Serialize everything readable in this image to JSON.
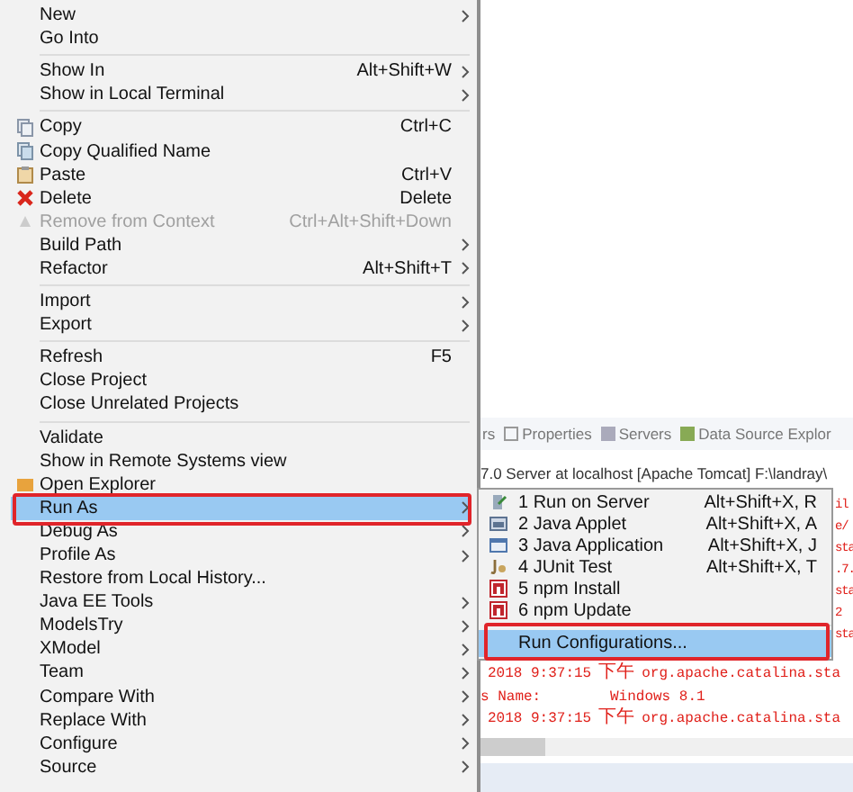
{
  "context_menu": {
    "sections": [
      [
        {
          "label": "New",
          "submenu": true,
          "disabled": false,
          "selected": false
        },
        {
          "label": "Go Into",
          "submenu": false,
          "disabled": false,
          "selected": false
        }
      ],
      [
        {
          "label": "Show In",
          "shortcut": "Alt+Shift+W",
          "submenu": true,
          "disabled": false,
          "selected": false
        },
        {
          "label": "Show in Local Terminal",
          "submenu": true,
          "disabled": false,
          "selected": false
        }
      ],
      [
        {
          "label": "Copy",
          "shortcut": "Ctrl+C",
          "submenu": false,
          "disabled": false,
          "selected": false
        },
        {
          "label": "Copy Qualified Name",
          "submenu": false,
          "disabled": false,
          "selected": false
        },
        {
          "label": "Paste",
          "shortcut": "Ctrl+V",
          "submenu": false,
          "disabled": false,
          "selected": false
        },
        {
          "label": "Delete",
          "shortcut": "Delete",
          "submenu": false,
          "disabled": false,
          "selected": false
        },
        {
          "label": "Remove from Context",
          "shortcut": "Ctrl+Alt+Shift+Down",
          "submenu": false,
          "disabled": true,
          "selected": false
        },
        {
          "label": "Build Path",
          "submenu": true,
          "disabled": false,
          "selected": false
        },
        {
          "label": "Refactor",
          "shortcut": "Alt+Shift+T",
          "submenu": true,
          "disabled": false,
          "selected": false
        }
      ],
      [
        {
          "label": "Import",
          "submenu": true,
          "disabled": false,
          "selected": false
        },
        {
          "label": "Export",
          "submenu": true,
          "disabled": false,
          "selected": false
        }
      ],
      [
        {
          "label": "Refresh",
          "shortcut": "F5",
          "submenu": false,
          "disabled": false,
          "selected": false
        },
        {
          "label": "Close Project",
          "submenu": false,
          "disabled": false,
          "selected": false
        },
        {
          "label": "Close Unrelated Projects",
          "submenu": false,
          "disabled": false,
          "selected": false
        }
      ],
      [
        {
          "label": "Validate",
          "submenu": false,
          "disabled": false,
          "selected": false
        },
        {
          "label": "Show in Remote Systems view",
          "submenu": false,
          "disabled": false,
          "selected": false
        },
        {
          "label": "Open Explorer",
          "submenu": false,
          "disabled": false,
          "selected": false
        },
        {
          "label": "Run As",
          "submenu": true,
          "disabled": false,
          "selected": true
        },
        {
          "label": "Debug As",
          "submenu": true,
          "disabled": false,
          "selected": false
        },
        {
          "label": "Profile As",
          "submenu": true,
          "disabled": false,
          "selected": false
        },
        {
          "label": "Restore from Local History...",
          "submenu": false,
          "disabled": false,
          "selected": false
        },
        {
          "label": "Java EE Tools",
          "submenu": true,
          "disabled": false,
          "selected": false
        },
        {
          "label": "ModelsTry",
          "submenu": true,
          "disabled": false,
          "selected": false
        },
        {
          "label": "XModel",
          "submenu": true,
          "disabled": false,
          "selected": false
        },
        {
          "label": "Team",
          "submenu": true,
          "disabled": false,
          "selected": false
        },
        {
          "label": "Compare With",
          "submenu": true,
          "disabled": false,
          "selected": false
        },
        {
          "label": "Replace With",
          "submenu": true,
          "disabled": false,
          "selected": false
        },
        {
          "label": "Configure",
          "submenu": true,
          "disabled": false,
          "selected": false
        },
        {
          "label": "Source",
          "submenu": true,
          "disabled": false,
          "selected": false
        }
      ]
    ]
  },
  "run_as_submenu": {
    "sections": [
      [
        {
          "label": "1 Run on Server",
          "shortcut": "Alt+Shift+X, R",
          "selected": false
        },
        {
          "label": "2 Java Applet",
          "shortcut": "Alt+Shift+X, A",
          "selected": false
        },
        {
          "label": "3 Java Application",
          "shortcut": "Alt+Shift+X, J",
          "selected": false
        },
        {
          "label": "4 JUnit Test",
          "shortcut": "Alt+Shift+X, T",
          "selected": false
        },
        {
          "label": "5 npm Install",
          "selected": false
        },
        {
          "label": "6 npm Update",
          "selected": false
        }
      ],
      [
        {
          "label": "Run Configurations...",
          "selected": true
        }
      ]
    ]
  },
  "console_view": {
    "tabs": [
      {
        "label": "rs",
        "selected": false
      },
      {
        "label": "Properties",
        "selected": false
      },
      {
        "label": "Servers",
        "selected": false
      },
      {
        "label": "Data Source Explor",
        "selected": false
      }
    ],
    "title": "7.0 Server at localhost [Apache Tomcat] F:\\landray\\",
    "line_tails": [
      "il",
      "e/",
      "sta",
      ".7.",
      "sta",
      "2",
      "sta"
    ],
    "log_lines": [
      {
        "kind": "entry",
        "timestamp": "2018 9:37:15",
        "period": "下午",
        "source": "org.apache.catalina.sta"
      },
      {
        "kind": "field",
        "label": "s Name:",
        "value": "Windows 8.1"
      },
      {
        "kind": "entry",
        "timestamp": "2018 9:37:15",
        "period": "下午",
        "source": "org.apache.catalina.sta"
      }
    ]
  }
}
